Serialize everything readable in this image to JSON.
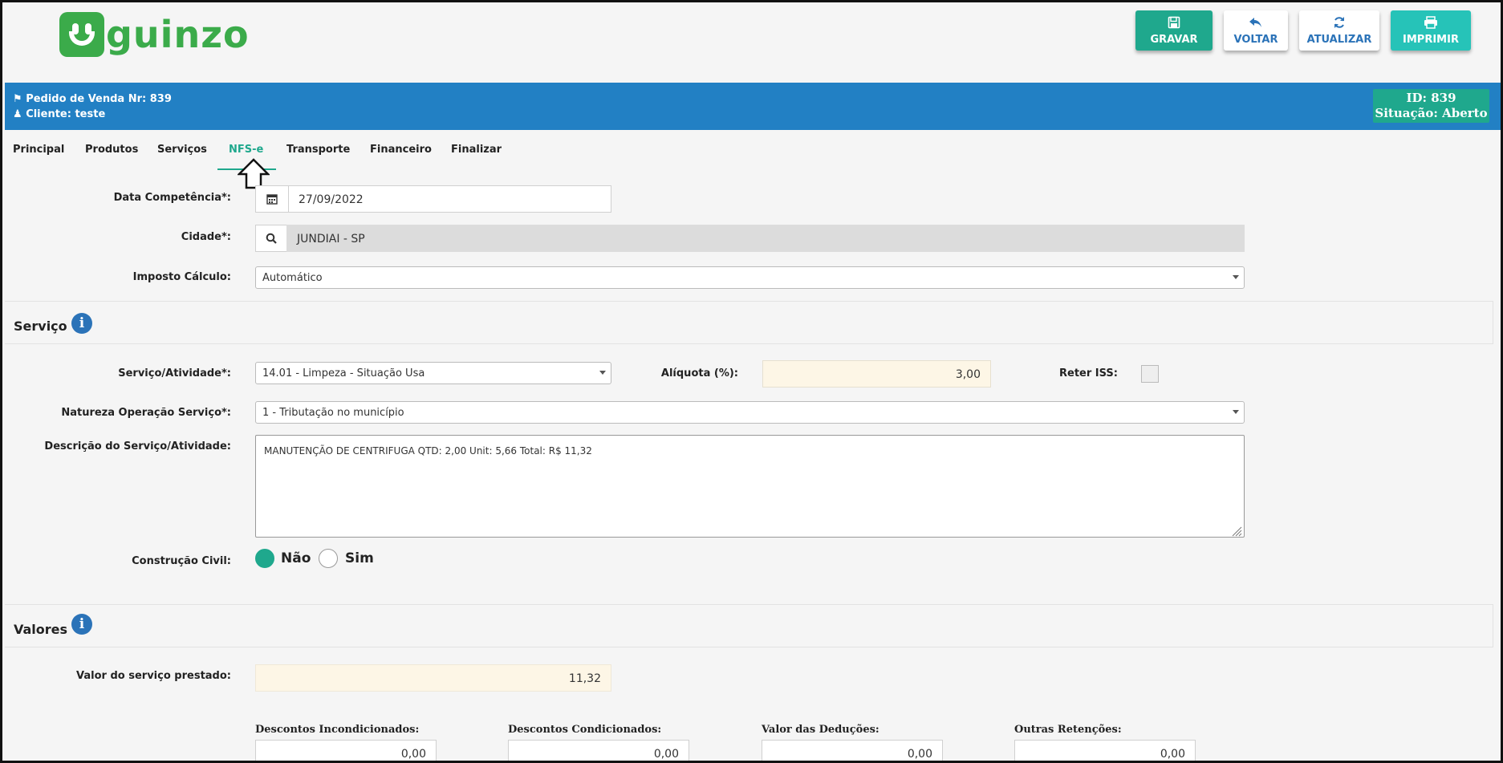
{
  "brand": {
    "name": "guinzo"
  },
  "toolbar": {
    "save": "GRAVAR",
    "back": "VOLTAR",
    "refresh": "ATUALIZAR",
    "print": "IMPRIMIR"
  },
  "header": {
    "order": "Pedido de Venda Nr: 839",
    "client": "Cliente: teste",
    "id": "ID: 839",
    "status": "Situação: Aberto"
  },
  "tabs": [
    {
      "label": "Principal"
    },
    {
      "label": "Produtos"
    },
    {
      "label": "Serviços"
    },
    {
      "label": "NFS-e",
      "active": true
    },
    {
      "label": "Transporte"
    },
    {
      "label": "Financeiro"
    },
    {
      "label": "Finalizar"
    }
  ],
  "form": {
    "data_competencia_label": "Data Competência*:",
    "data_competencia_value": "27/09/2022",
    "cidade_label": "Cidade*:",
    "cidade_value": "JUNDIAI - SP",
    "imposto_label": "Imposto Cálculo:",
    "imposto_value": "Automático"
  },
  "servico": {
    "title": "Serviço",
    "atividade_label": "Serviço/Atividade*:",
    "atividade_value": "14.01 - Limpeza - Situação Usa",
    "aliquota_label": "Alíquota (%):",
    "aliquota_value": "3,00",
    "reter_label": "Reter ISS:",
    "natureza_label": "Natureza Operação Serviço*:",
    "natureza_value": "1 - Tributação no município",
    "descricao_label": "Descrição do Serviço/Atividade:",
    "descricao_value": "MANUTENÇÃO DE CENTRIFUGA QTD: 2,00 Unit: 5,66 Total: R$ 11,32",
    "construcao_label": "Construção Civil:",
    "construcao_nao": "Não",
    "construcao_sim": "Sim"
  },
  "valores": {
    "title": "Valores",
    "valor_label": "Valor do serviço prestado:",
    "valor_value": "11,32",
    "desc_incond_label": "Descontos Incondicionados:",
    "desc_incond_value": "0,00",
    "desc_cond_label": "Descontos Condicionados:",
    "desc_cond_value": "0,00",
    "deducoes_label": "Valor das Deduções:",
    "deducoes_value": "0,00",
    "outras_label": "Outras Retenções:",
    "outras_value": "0,00"
  },
  "colors": {
    "primary_green": "#1fa88d",
    "brand_green": "#3bab4a",
    "header_blue": "#2280c4",
    "highlight_field": "#fdf6e6"
  }
}
